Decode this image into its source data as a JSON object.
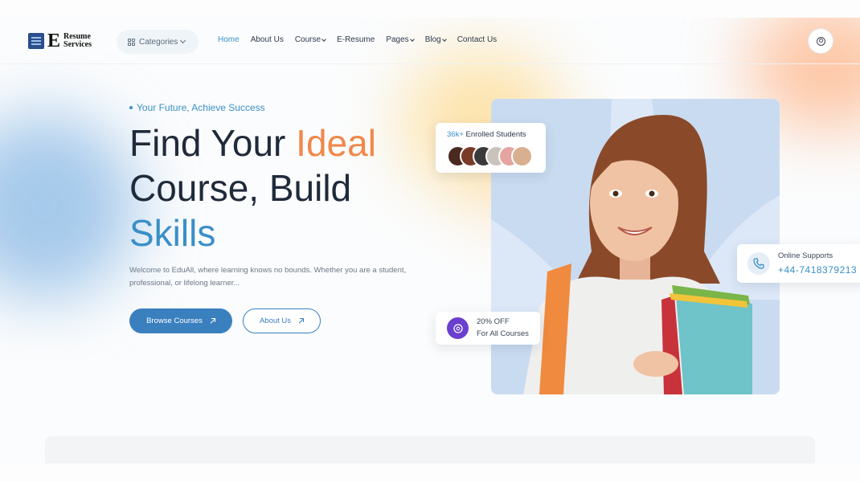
{
  "header": {
    "logo": {
      "letter": "E",
      "line1": "Resume",
      "line2": "Services"
    },
    "categories_label": "Categories",
    "nav": [
      {
        "label": "Home",
        "active": true,
        "dropdown": false
      },
      {
        "label": "About Us",
        "active": false,
        "dropdown": false
      },
      {
        "label": "Course",
        "active": false,
        "dropdown": true
      },
      {
        "label": "E-Resume",
        "active": false,
        "dropdown": false
      },
      {
        "label": "Pages",
        "active": false,
        "dropdown": true
      },
      {
        "label": "Blog",
        "active": false,
        "dropdown": true
      },
      {
        "label": "Contact Us",
        "active": false,
        "dropdown": false
      }
    ],
    "user_icon": "user-circle-icon"
  },
  "hero": {
    "tagline": "Your Future, Achieve Success",
    "title_line1_a": "Find Your ",
    "title_line1_b": "Ideal",
    "title_line2": "Course, Build",
    "title_line3": "Skills",
    "description": "Welcome to EduAll, where learning knows no bounds. Whether you are a student, professional, or lifelong learner...",
    "primary_button": "Browse Courses",
    "secondary_button": "About Us"
  },
  "cards": {
    "students": {
      "count": "36k+",
      "label": "Enrolled Students",
      "avatar_count": 6
    },
    "support": {
      "title": "Online Supports",
      "phone": "+44-7418379213"
    },
    "discount": {
      "line1": "20% OFF",
      "line2": "For All Courses"
    }
  },
  "colors": {
    "accent_blue": "#3a8fc8",
    "accent_orange": "#f0884a",
    "button_blue": "#3a80bf",
    "discount_purple": "#6a3fcf"
  }
}
